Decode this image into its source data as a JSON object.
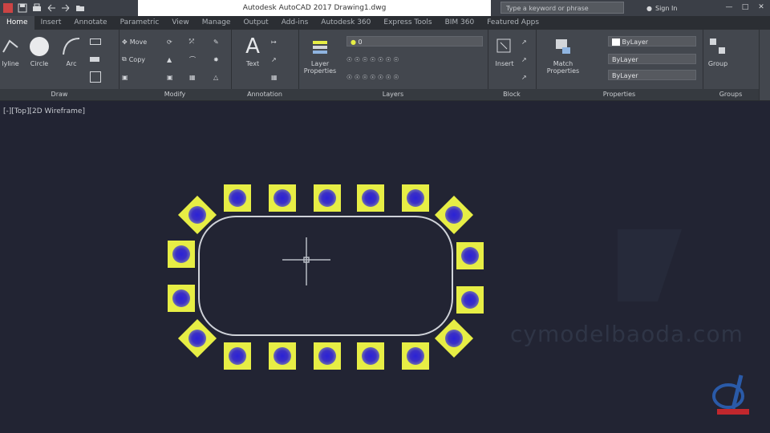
{
  "window": {
    "title": "Autodesk AutoCAD 2017    Drawing1.dwg"
  },
  "search": {
    "placeholder": "Type a keyword or phrase"
  },
  "account": {
    "signin_label": "Sign In"
  },
  "tabs": [
    "Home",
    "Insert",
    "Annotate",
    "Parametric",
    "View",
    "Manage",
    "Output",
    "Add-ins",
    "Autodesk 360",
    "Express Tools",
    "BIM 360",
    "Featured Apps"
  ],
  "draw_panel": {
    "title": "Draw",
    "polyline": "lyline",
    "circle": "Circle",
    "arc": "Arc"
  },
  "modify_panel": {
    "title": "Modify",
    "move": "Move",
    "copy": "Copy"
  },
  "annotation_panel": {
    "title": "Annotation",
    "text": "Text"
  },
  "layers_panel": {
    "title": "Layers",
    "layer_properties": "Layer Properties",
    "current_layer": "0"
  },
  "block_panel": {
    "title": "Block",
    "insert": "Insert"
  },
  "properties_panel": {
    "title": "Properties",
    "match": "Match Properties",
    "color": "ByLayer",
    "linetype": "ByLayer",
    "lineweight": "ByLayer"
  },
  "groups_panel": {
    "title": "Groups",
    "group": "Group"
  },
  "viewport": {
    "label": "[-][Top][2D Wireframe]"
  },
  "watermark": {
    "text": "cymodelbaoda.com"
  },
  "brand_colors": {
    "pad_fill": "#e7ee45",
    "pad_dot": "#2a22d6",
    "outline": "#cfd2d8",
    "background": "#222433"
  }
}
